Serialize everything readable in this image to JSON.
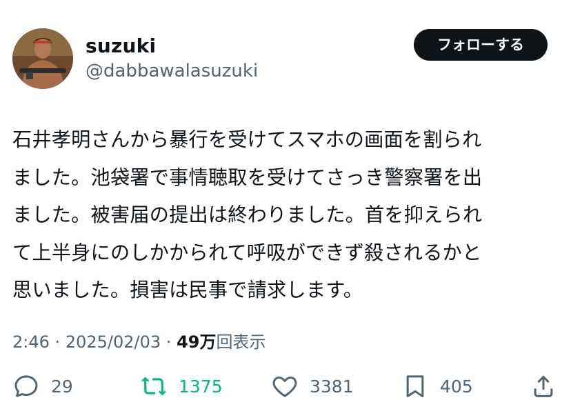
{
  "user": {
    "display_name": "suzuki",
    "handle": "@dabbawalasuzuki",
    "avatar_icon": "profile-photo"
  },
  "follow_button": {
    "label": "フォローする"
  },
  "tweet": {
    "lines": [
      "石井孝明さんから暴行を受けてスマホの画面を割られ",
      "ました。池袋署で事情聴取を受けてさっき警察署を出",
      "ました。被害届の提出は終わりました。首を抑えられ",
      "て上半身にのしかかられて呼吸ができず殺されるかと",
      "思いました。損害は民事で請求します。"
    ]
  },
  "meta": {
    "time": "2:46",
    "separator": "·",
    "date": "2025/02/03",
    "views_count": "49万",
    "views_label": "回表示"
  },
  "actions": {
    "reply_count": "29",
    "retweet_count": "1375",
    "like_count": "3381",
    "bookmark_count": "405"
  },
  "colors": {
    "text": "#0f1419",
    "secondary": "#536471",
    "retweet_green": "#00ba7c",
    "button_bg": "#0f1419"
  }
}
